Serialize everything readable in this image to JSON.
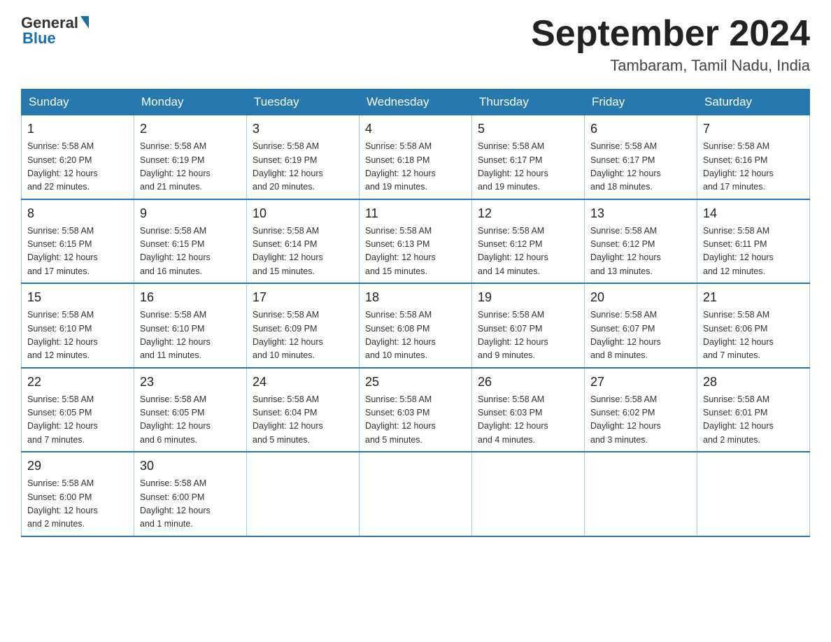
{
  "header": {
    "logo_general": "General",
    "logo_blue": "Blue",
    "month_year": "September 2024",
    "location": "Tambaram, Tamil Nadu, India"
  },
  "days_of_week": [
    "Sunday",
    "Monday",
    "Tuesday",
    "Wednesday",
    "Thursday",
    "Friday",
    "Saturday"
  ],
  "weeks": [
    [
      {
        "day": "1",
        "sunrise": "5:58 AM",
        "sunset": "6:20 PM",
        "daylight": "12 hours and 22 minutes."
      },
      {
        "day": "2",
        "sunrise": "5:58 AM",
        "sunset": "6:19 PM",
        "daylight": "12 hours and 21 minutes."
      },
      {
        "day": "3",
        "sunrise": "5:58 AM",
        "sunset": "6:19 PM",
        "daylight": "12 hours and 20 minutes."
      },
      {
        "day": "4",
        "sunrise": "5:58 AM",
        "sunset": "6:18 PM",
        "daylight": "12 hours and 19 minutes."
      },
      {
        "day": "5",
        "sunrise": "5:58 AM",
        "sunset": "6:17 PM",
        "daylight": "12 hours and 19 minutes."
      },
      {
        "day": "6",
        "sunrise": "5:58 AM",
        "sunset": "6:17 PM",
        "daylight": "12 hours and 18 minutes."
      },
      {
        "day": "7",
        "sunrise": "5:58 AM",
        "sunset": "6:16 PM",
        "daylight": "12 hours and 17 minutes."
      }
    ],
    [
      {
        "day": "8",
        "sunrise": "5:58 AM",
        "sunset": "6:15 PM",
        "daylight": "12 hours and 17 minutes."
      },
      {
        "day": "9",
        "sunrise": "5:58 AM",
        "sunset": "6:15 PM",
        "daylight": "12 hours and 16 minutes."
      },
      {
        "day": "10",
        "sunrise": "5:58 AM",
        "sunset": "6:14 PM",
        "daylight": "12 hours and 15 minutes."
      },
      {
        "day": "11",
        "sunrise": "5:58 AM",
        "sunset": "6:13 PM",
        "daylight": "12 hours and 15 minutes."
      },
      {
        "day": "12",
        "sunrise": "5:58 AM",
        "sunset": "6:12 PM",
        "daylight": "12 hours and 14 minutes."
      },
      {
        "day": "13",
        "sunrise": "5:58 AM",
        "sunset": "6:12 PM",
        "daylight": "12 hours and 13 minutes."
      },
      {
        "day": "14",
        "sunrise": "5:58 AM",
        "sunset": "6:11 PM",
        "daylight": "12 hours and 12 minutes."
      }
    ],
    [
      {
        "day": "15",
        "sunrise": "5:58 AM",
        "sunset": "6:10 PM",
        "daylight": "12 hours and 12 minutes."
      },
      {
        "day": "16",
        "sunrise": "5:58 AM",
        "sunset": "6:10 PM",
        "daylight": "12 hours and 11 minutes."
      },
      {
        "day": "17",
        "sunrise": "5:58 AM",
        "sunset": "6:09 PM",
        "daylight": "12 hours and 10 minutes."
      },
      {
        "day": "18",
        "sunrise": "5:58 AM",
        "sunset": "6:08 PM",
        "daylight": "12 hours and 10 minutes."
      },
      {
        "day": "19",
        "sunrise": "5:58 AM",
        "sunset": "6:07 PM",
        "daylight": "12 hours and 9 minutes."
      },
      {
        "day": "20",
        "sunrise": "5:58 AM",
        "sunset": "6:07 PM",
        "daylight": "12 hours and 8 minutes."
      },
      {
        "day": "21",
        "sunrise": "5:58 AM",
        "sunset": "6:06 PM",
        "daylight": "12 hours and 7 minutes."
      }
    ],
    [
      {
        "day": "22",
        "sunrise": "5:58 AM",
        "sunset": "6:05 PM",
        "daylight": "12 hours and 7 minutes."
      },
      {
        "day": "23",
        "sunrise": "5:58 AM",
        "sunset": "6:05 PM",
        "daylight": "12 hours and 6 minutes."
      },
      {
        "day": "24",
        "sunrise": "5:58 AM",
        "sunset": "6:04 PM",
        "daylight": "12 hours and 5 minutes."
      },
      {
        "day": "25",
        "sunrise": "5:58 AM",
        "sunset": "6:03 PM",
        "daylight": "12 hours and 5 minutes."
      },
      {
        "day": "26",
        "sunrise": "5:58 AM",
        "sunset": "6:03 PM",
        "daylight": "12 hours and 4 minutes."
      },
      {
        "day": "27",
        "sunrise": "5:58 AM",
        "sunset": "6:02 PM",
        "daylight": "12 hours and 3 minutes."
      },
      {
        "day": "28",
        "sunrise": "5:58 AM",
        "sunset": "6:01 PM",
        "daylight": "12 hours and 2 minutes."
      }
    ],
    [
      {
        "day": "29",
        "sunrise": "5:58 AM",
        "sunset": "6:00 PM",
        "daylight": "12 hours and 2 minutes."
      },
      {
        "day": "30",
        "sunrise": "5:58 AM",
        "sunset": "6:00 PM",
        "daylight": "12 hours and 1 minute."
      },
      null,
      null,
      null,
      null,
      null
    ]
  ],
  "labels": {
    "sunrise": "Sunrise:",
    "sunset": "Sunset:",
    "daylight": "Daylight:"
  }
}
